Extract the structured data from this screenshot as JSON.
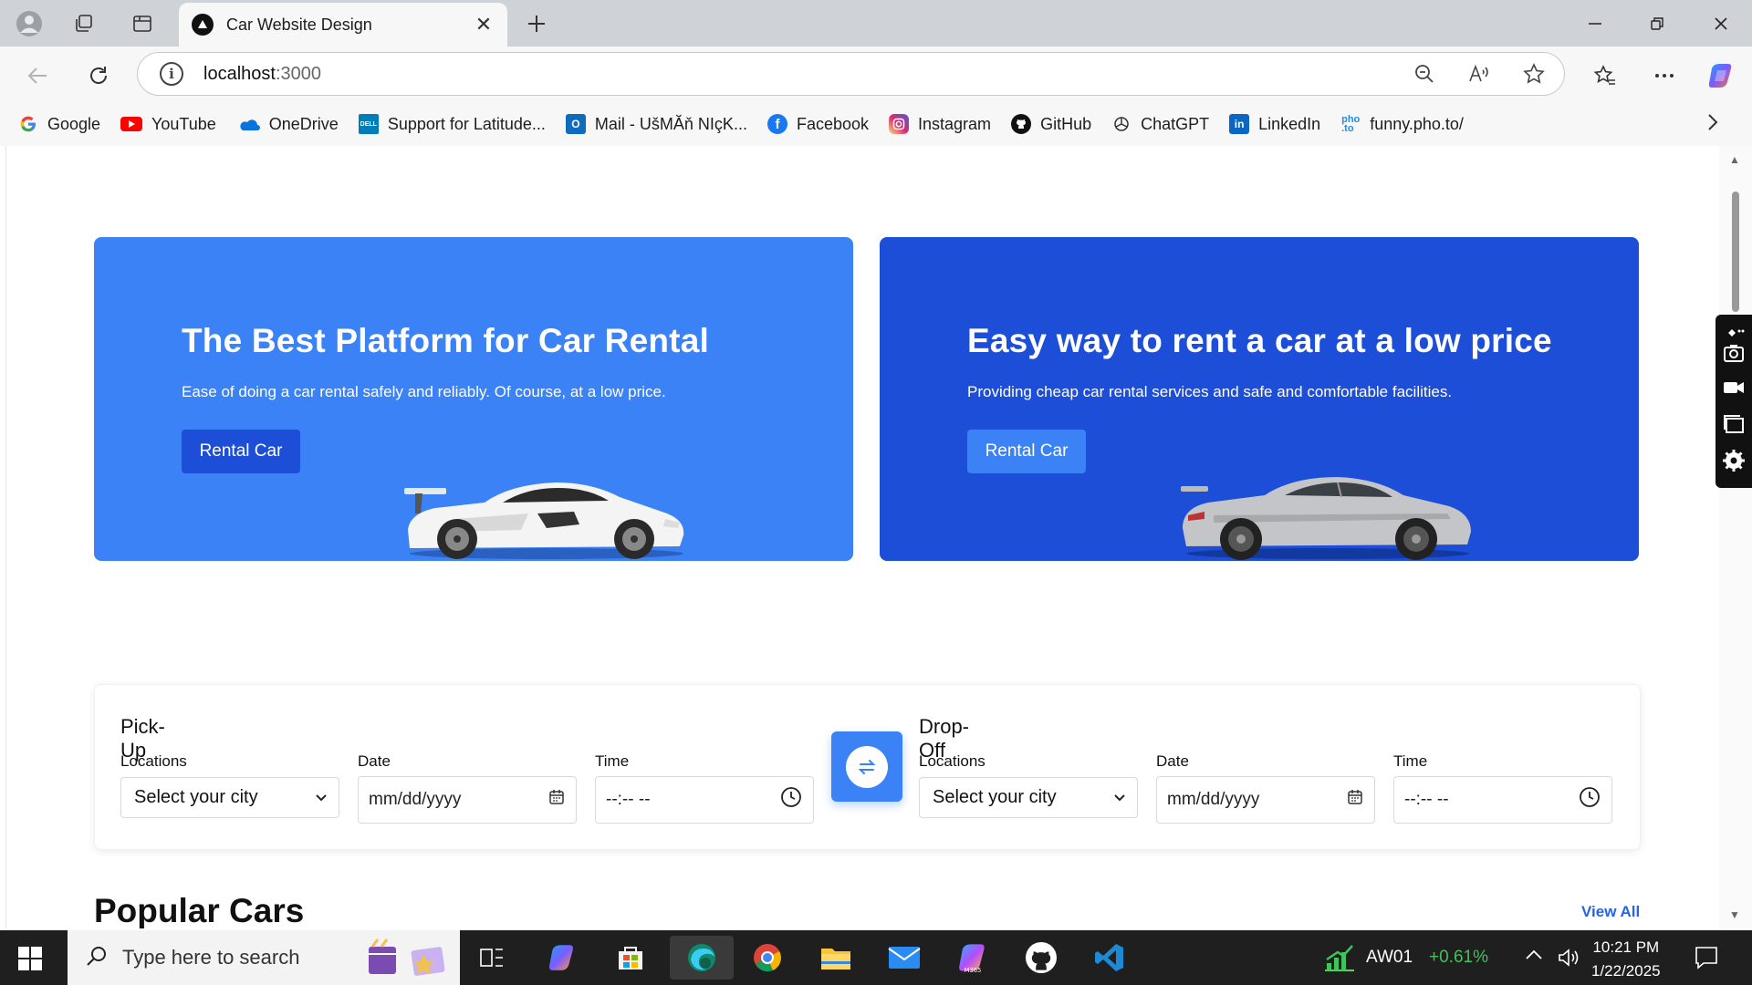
{
  "browser": {
    "tab_title": "Car Website Design",
    "url_host": "localhost",
    "url_port": ":3000",
    "bookmarks": [
      {
        "label": "Google",
        "icon": "google-icon",
        "color": "#4285f4"
      },
      {
        "label": "YouTube",
        "icon": "youtube-icon",
        "color": "#ff0000"
      },
      {
        "label": "OneDrive",
        "icon": "onedrive-icon",
        "color": "#0a74da"
      },
      {
        "label": "Support for Latitude...",
        "icon": "dell-icon",
        "color": "#007db8"
      },
      {
        "label": "Mail - UšMĂň NIçK...",
        "icon": "outlook-icon",
        "color": "#0f6cbd"
      },
      {
        "label": "Facebook",
        "icon": "facebook-icon",
        "color": "#1877f2"
      },
      {
        "label": "Instagram",
        "icon": "instagram-icon",
        "color": "#d62976"
      },
      {
        "label": "GitHub",
        "icon": "github-icon",
        "color": "#111111"
      },
      {
        "label": "ChatGPT",
        "icon": "chatgpt-icon",
        "color": "#333333"
      },
      {
        "label": "LinkedIn",
        "icon": "linkedin-icon",
        "color": "#0a66c2"
      },
      {
        "label": "funny.pho.to/",
        "icon": "photo-icon",
        "color": "#2a8bd8"
      }
    ]
  },
  "hero": [
    {
      "title": "The Best Platform for Car Rental",
      "subtitle": "Ease of doing a car rental safely and reliably. Of course, at a low price.",
      "button": "Rental Car",
      "background": "#3b82f6"
    },
    {
      "title": "Easy way to rent a car at a low price",
      "subtitle": "Providing cheap car rental services and safe and comfortable facilities.",
      "button": "Rental Car",
      "background": "#1d4ed8"
    }
  ],
  "booking": {
    "pickup": {
      "title": "Pick-Up",
      "locations_label": "Locations",
      "locations_value": "Select your city",
      "date_label": "Date",
      "date_placeholder": "mm/dd/yyyy",
      "time_label": "Time",
      "time_placeholder": "--:-- --"
    },
    "dropoff": {
      "title": "Drop-Off",
      "locations_label": "Locations",
      "locations_value": "Select your city",
      "date_label": "Date",
      "date_placeholder": "mm/dd/yyyy",
      "time_label": "Time",
      "time_placeholder": "--:-- --"
    }
  },
  "popular": {
    "title": "Popular Cars",
    "view_all": "View All"
  },
  "taskbar": {
    "search_placeholder": "Type here to search",
    "stock_name": "AW01",
    "stock_change": "+0.61%",
    "time": "10:21 PM",
    "date": "1/22/2025"
  },
  "colors": {
    "accent": "#3b82f6",
    "accent_dark": "#1d4ed8",
    "link": "#2563eb",
    "stock_up": "#3fc35b"
  }
}
